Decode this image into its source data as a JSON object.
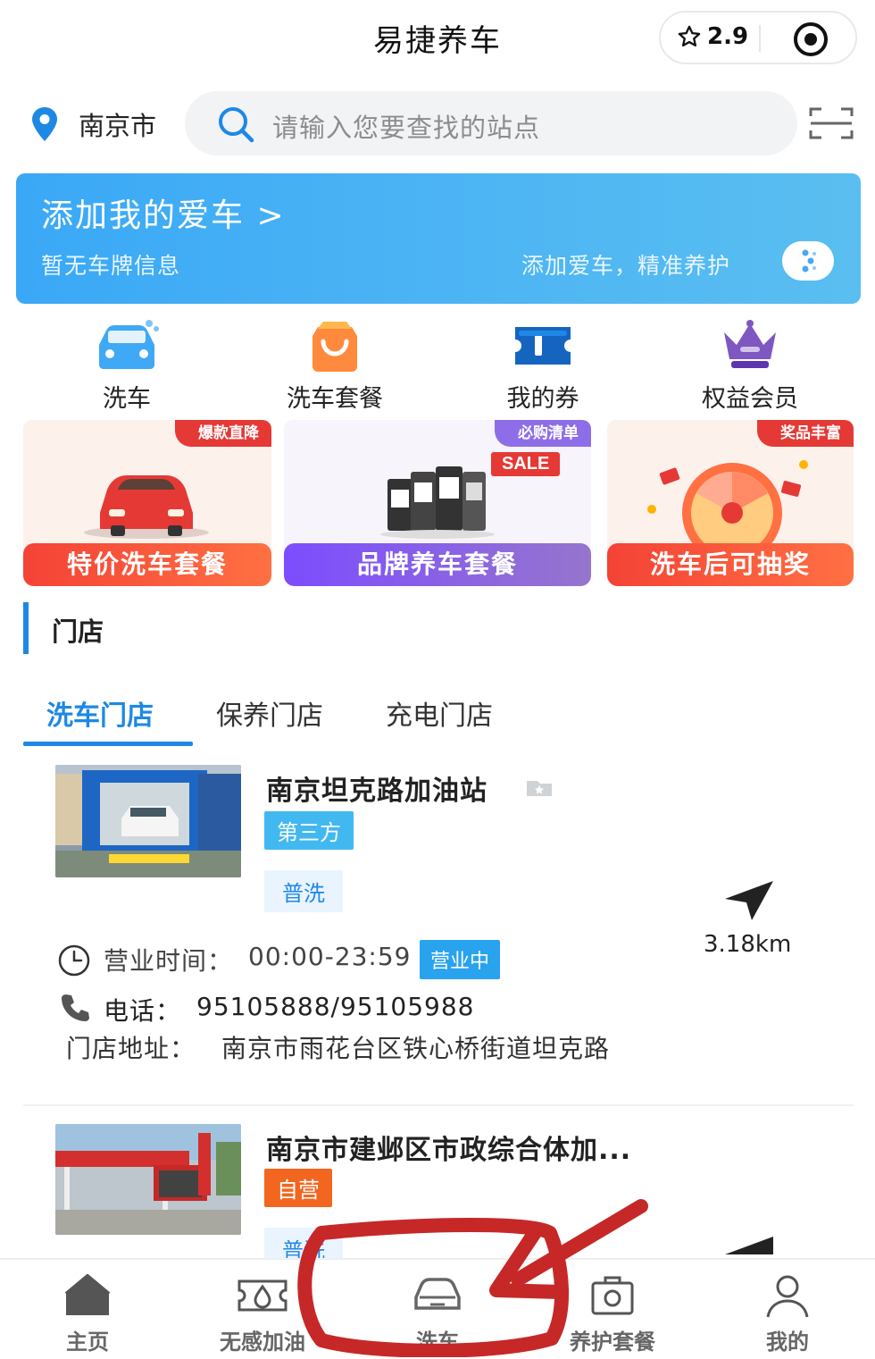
{
  "header": {
    "title": "易捷养车",
    "rating": "2.9"
  },
  "location": {
    "city": "南京市"
  },
  "search": {
    "placeholder": "请输入您要查找的站点"
  },
  "banner": {
    "title": "添加我的爱车 >",
    "subtitle": "暂无车牌信息",
    "hint": "添加爱车，精准养护"
  },
  "quick_actions": [
    {
      "label": "洗车",
      "icon": "car-wash-icon"
    },
    {
      "label": "洗车套餐",
      "icon": "shopping-bag-icon"
    },
    {
      "label": "我的券",
      "icon": "ticket-icon"
    },
    {
      "label": "权益会员",
      "icon": "crown-icon"
    }
  ],
  "promos": [
    {
      "tag": "爆款直降",
      "title": "特价洗车套餐",
      "colors": [
        "#f44336",
        "#ff7043"
      ]
    },
    {
      "tag": "必购清单",
      "sale": "SALE",
      "title": "品牌养车套餐",
      "colors": [
        "#7c4dff",
        "#9575cd"
      ]
    },
    {
      "tag": "奖品丰富",
      "title": "洗车后可抽奖",
      "colors": [
        "#f44336",
        "#ff7043"
      ]
    }
  ],
  "section": {
    "title": "门店"
  },
  "tabs": [
    {
      "label": "洗车门店"
    },
    {
      "label": "保养门店"
    },
    {
      "label": "充电门店"
    }
  ],
  "stores": [
    {
      "name": "南京坦克路加油站",
      "type_badge": "第三方",
      "service": "普洗",
      "hours_label": "营业时间：",
      "hours": "00:00-23:59",
      "status": "营业中",
      "phone_label": "电话：",
      "phone": "95105888/95105988",
      "address_label": "门店地址：",
      "address": "南京市雨花台区铁心桥街道坦克路",
      "distance": "3.18km"
    },
    {
      "name": "南京市建邺区市政综合体加...",
      "type_badge": "自营",
      "service": "普洗"
    }
  ],
  "bottom_nav": [
    {
      "label": "主页",
      "icon": "home-icon"
    },
    {
      "label": "无感加油",
      "icon": "fuel-ticket-icon"
    },
    {
      "label": "洗车",
      "icon": "car-icon"
    },
    {
      "label": "养护套餐",
      "icon": "camera-bag-icon"
    },
    {
      "label": "我的",
      "icon": "user-icon"
    }
  ],
  "colors": {
    "accent": "#1e88e5",
    "annotation": "#c62828"
  }
}
